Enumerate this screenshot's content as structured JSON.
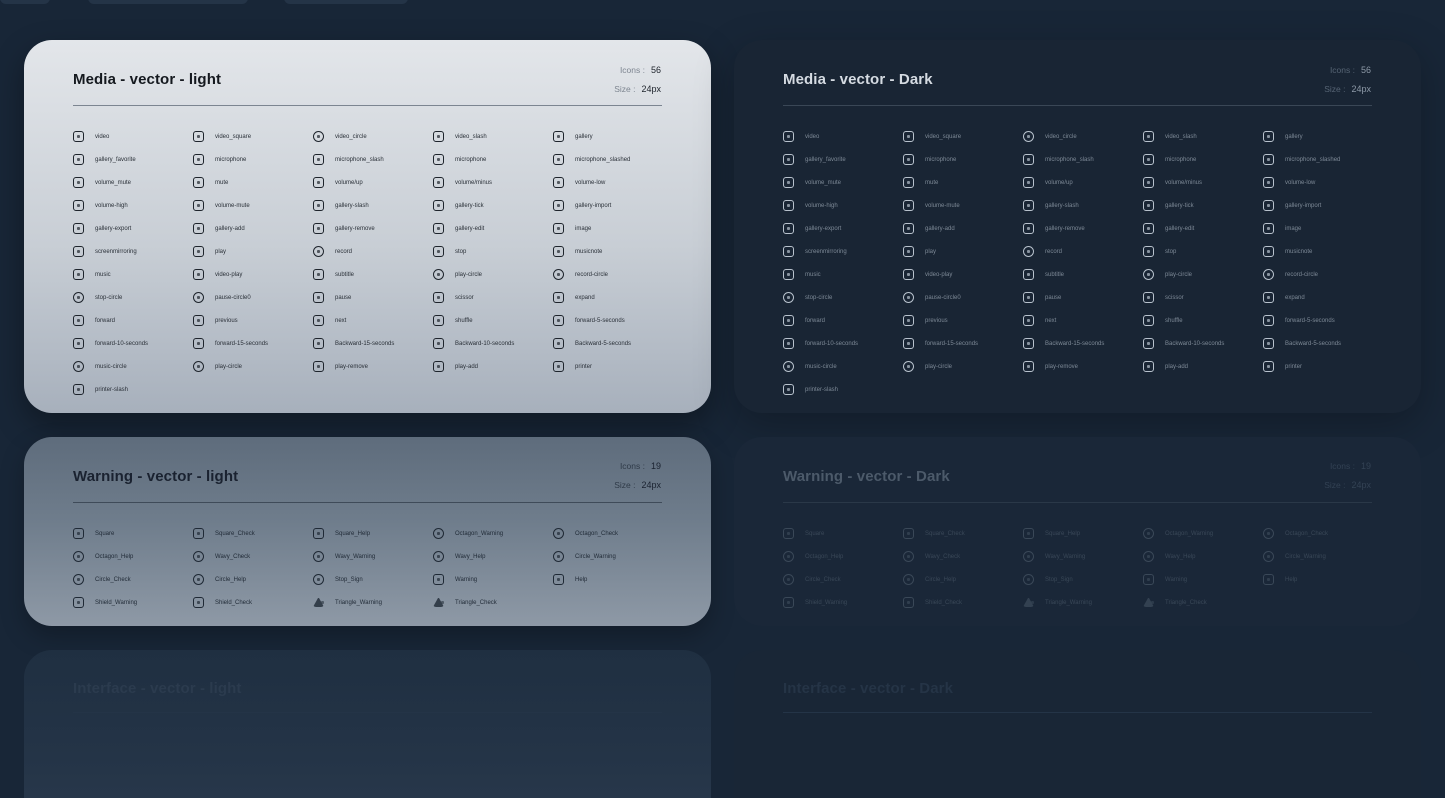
{
  "cards": [
    {
      "title": "Media - vector - light",
      "icons_label": "Icons :",
      "icons_count": "56",
      "size_label": "Size :",
      "size_value": "24px",
      "items": [
        "video",
        "video_square",
        "video_circle",
        "video_slash",
        "gallery",
        "gallery_favorite",
        "microphone",
        "microphone_slash",
        "microphone",
        "microphone_slashed",
        "volume_mute",
        "mute",
        "volume/up",
        "volume/minus",
        "volume-low",
        "volume-high",
        "volume-mute",
        "gallery-slash",
        "gallery-tick",
        "gallery-import",
        "gallery-export",
        "gallery-add",
        "gallery-remove",
        "gallery-edit",
        "image",
        "screenmirroring",
        "play",
        "record",
        "stop",
        "musicnote",
        "music",
        "video-play",
        "subtitle",
        "play-circle",
        "record-circle",
        "stop-circle",
        "pause-circle0",
        "pause",
        "scissor",
        "expand",
        "forward",
        "previous",
        "next",
        "shuffle",
        "forward-5-seconds",
        "forward-10-seconds",
        "forward-15-seconds",
        "Backward-15-seconds",
        "Backward-10-seconds",
        "Backward-5-seconds",
        "music-circle",
        "play-circle",
        "play-remove",
        "play-add",
        "printer",
        "printer-slash"
      ]
    },
    {
      "title": "Media - vector - Dark",
      "icons_label": "Icons :",
      "icons_count": "56",
      "size_label": "Size :",
      "size_value": "24px",
      "items": [
        "video",
        "video_square",
        "video_circle",
        "video_slash",
        "gallery",
        "gallery_favorite",
        "microphone",
        "microphone_slash",
        "microphone",
        "microphone_slashed",
        "volume_mute",
        "mute",
        "volume/up",
        "volume/minus",
        "volume-low",
        "volume-high",
        "volume-mute",
        "gallery-slash",
        "gallery-tick",
        "gallery-import",
        "gallery-export",
        "gallery-add",
        "gallery-remove",
        "gallery-edit",
        "image",
        "screenmirroring",
        "play",
        "record",
        "stop",
        "musicnote",
        "music",
        "video-play",
        "subtitle",
        "play-circle",
        "record-circle",
        "stop-circle",
        "pause-circle0",
        "pause",
        "scissor",
        "expand",
        "forward",
        "previous",
        "next",
        "shuffle",
        "forward-5-seconds",
        "forward-10-seconds",
        "forward-15-seconds",
        "Backward-15-seconds",
        "Backward-10-seconds",
        "Backward-5-seconds",
        "music-circle",
        "play-circle",
        "play-remove",
        "play-add",
        "printer",
        "printer-slash"
      ]
    },
    {
      "title": "Warning - vector - light",
      "icons_label": "Icons :",
      "icons_count": "19",
      "size_label": "Size :",
      "size_value": "24px",
      "items": [
        "Square",
        "Square_Check",
        "Square_Help",
        "Octagon_Warning",
        "Octagon_Check",
        "Octagon_Help",
        "Wavy_Check",
        "Wavy_Warning",
        "Wavy_Help",
        "Circle_Warning",
        "Circle_Check",
        "Circle_Help",
        "Stop_Sign",
        "Warning",
        "Help",
        "Shield_Warning",
        "Shield_Check",
        "Triangle_Warning",
        "Triangle_Check"
      ]
    },
    {
      "title": "Warning - vector - Dark",
      "icons_label": "Icons :",
      "icons_count": "19",
      "size_label": "Size :",
      "size_value": "24px",
      "items": [
        "Square",
        "Square_Check",
        "Square_Help",
        "Octagon_Warning",
        "Octagon_Check",
        "Octagon_Help",
        "Wavy_Check",
        "Wavy_Warning",
        "Wavy_Help",
        "Circle_Warning",
        "Circle_Check",
        "Circle_Help",
        "Stop_Sign",
        "Warning",
        "Help",
        "Shield_Warning",
        "Shield_Check",
        "Triangle_Warning",
        "Triangle_Check"
      ]
    },
    {
      "title": "Interface - vector - light",
      "icons_label": "",
      "icons_count": "",
      "size_label": "",
      "size_value": "",
      "items": []
    },
    {
      "title": "Interface - vector - Dark",
      "icons_label": "",
      "icons_count": "",
      "size_label": "",
      "size_value": "",
      "items": []
    }
  ]
}
